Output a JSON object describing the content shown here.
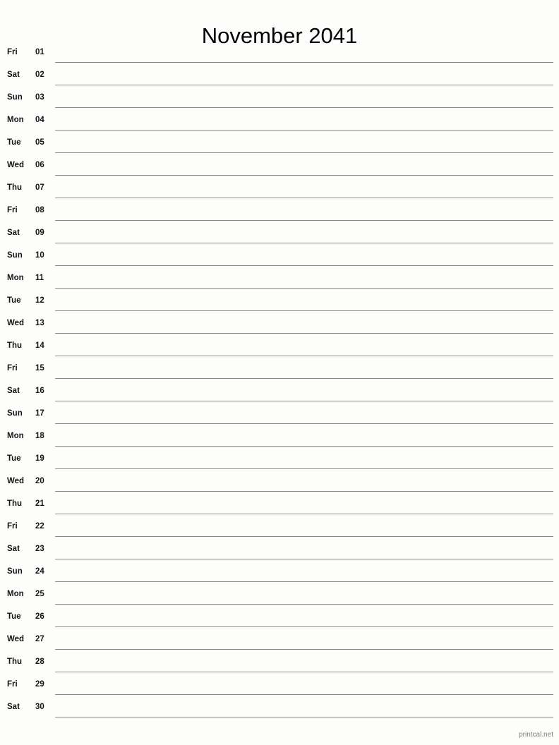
{
  "document": {
    "title": "November 2041",
    "month": "November",
    "year": "2041",
    "watermark": "printcal.net",
    "colors": {
      "background": "#fdfdfb",
      "text": "#141414",
      "rule": "#8a8d87",
      "watermark": "#7d7d7d"
    }
  },
  "days": [
    {
      "weekday": "Fri",
      "number": "01"
    },
    {
      "weekday": "Sat",
      "number": "02"
    },
    {
      "weekday": "Sun",
      "number": "03"
    },
    {
      "weekday": "Mon",
      "number": "04"
    },
    {
      "weekday": "Tue",
      "number": "05"
    },
    {
      "weekday": "Wed",
      "number": "06"
    },
    {
      "weekday": "Thu",
      "number": "07"
    },
    {
      "weekday": "Fri",
      "number": "08"
    },
    {
      "weekday": "Sat",
      "number": "09"
    },
    {
      "weekday": "Sun",
      "number": "10"
    },
    {
      "weekday": "Mon",
      "number": "11"
    },
    {
      "weekday": "Tue",
      "number": "12"
    },
    {
      "weekday": "Wed",
      "number": "13"
    },
    {
      "weekday": "Thu",
      "number": "14"
    },
    {
      "weekday": "Fri",
      "number": "15"
    },
    {
      "weekday": "Sat",
      "number": "16"
    },
    {
      "weekday": "Sun",
      "number": "17"
    },
    {
      "weekday": "Mon",
      "number": "18"
    },
    {
      "weekday": "Tue",
      "number": "19"
    },
    {
      "weekday": "Wed",
      "number": "20"
    },
    {
      "weekday": "Thu",
      "number": "21"
    },
    {
      "weekday": "Fri",
      "number": "22"
    },
    {
      "weekday": "Sat",
      "number": "23"
    },
    {
      "weekday": "Sun",
      "number": "24"
    },
    {
      "weekday": "Mon",
      "number": "25"
    },
    {
      "weekday": "Tue",
      "number": "26"
    },
    {
      "weekday": "Wed",
      "number": "27"
    },
    {
      "weekday": "Thu",
      "number": "28"
    },
    {
      "weekday": "Fri",
      "number": "29"
    },
    {
      "weekday": "Sat",
      "number": "30"
    }
  ]
}
